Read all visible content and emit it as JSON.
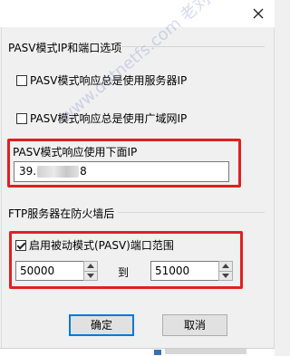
{
  "window": {
    "close_glyph": "✕"
  },
  "pasv_group": {
    "title": "PASV模式IP和端口选项",
    "always_server_ip": {
      "label": "PASV模式响应总是使用服务器IP",
      "checked": false
    },
    "always_wan_ip": {
      "label": "PASV模式响应总是使用广域网IP",
      "checked": false
    },
    "use_ip_label": "PASV模式响应使用下面IP",
    "ip_prefix": "39.",
    "ip_suffix": "8"
  },
  "firewall_group": {
    "title": "FTP服务器在防火墙后",
    "enable_range": {
      "label": "启用被动模式(PASV)端口范围",
      "checked": true
    },
    "port_from": "50000",
    "to_label": "到",
    "port_to": "51000"
  },
  "buttons": {
    "ok": "确定",
    "cancel": "取消"
  },
  "watermark": "www.dotnetfs.com 老刘软件",
  "colors": {
    "highlight": "#e02020",
    "accent": "#0078d7"
  }
}
